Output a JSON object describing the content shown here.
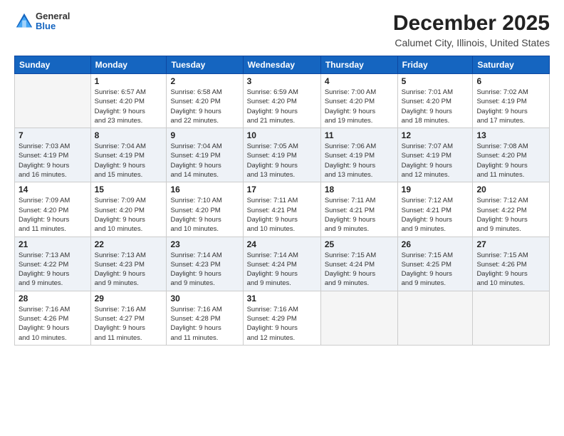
{
  "header": {
    "logo": {
      "general": "General",
      "blue": "Blue"
    },
    "title": "December 2025",
    "subtitle": "Calumet City, Illinois, United States"
  },
  "calendar": {
    "days_of_week": [
      "Sunday",
      "Monday",
      "Tuesday",
      "Wednesday",
      "Thursday",
      "Friday",
      "Saturday"
    ],
    "weeks": [
      [
        {
          "num": "",
          "info": ""
        },
        {
          "num": "1",
          "info": "Sunrise: 6:57 AM\nSunset: 4:20 PM\nDaylight: 9 hours\nand 23 minutes."
        },
        {
          "num": "2",
          "info": "Sunrise: 6:58 AM\nSunset: 4:20 PM\nDaylight: 9 hours\nand 22 minutes."
        },
        {
          "num": "3",
          "info": "Sunrise: 6:59 AM\nSunset: 4:20 PM\nDaylight: 9 hours\nand 21 minutes."
        },
        {
          "num": "4",
          "info": "Sunrise: 7:00 AM\nSunset: 4:20 PM\nDaylight: 9 hours\nand 19 minutes."
        },
        {
          "num": "5",
          "info": "Sunrise: 7:01 AM\nSunset: 4:20 PM\nDaylight: 9 hours\nand 18 minutes."
        },
        {
          "num": "6",
          "info": "Sunrise: 7:02 AM\nSunset: 4:19 PM\nDaylight: 9 hours\nand 17 minutes."
        }
      ],
      [
        {
          "num": "7",
          "info": "Sunrise: 7:03 AM\nSunset: 4:19 PM\nDaylight: 9 hours\nand 16 minutes."
        },
        {
          "num": "8",
          "info": "Sunrise: 7:04 AM\nSunset: 4:19 PM\nDaylight: 9 hours\nand 15 minutes."
        },
        {
          "num": "9",
          "info": "Sunrise: 7:04 AM\nSunset: 4:19 PM\nDaylight: 9 hours\nand 14 minutes."
        },
        {
          "num": "10",
          "info": "Sunrise: 7:05 AM\nSunset: 4:19 PM\nDaylight: 9 hours\nand 13 minutes."
        },
        {
          "num": "11",
          "info": "Sunrise: 7:06 AM\nSunset: 4:19 PM\nDaylight: 9 hours\nand 13 minutes."
        },
        {
          "num": "12",
          "info": "Sunrise: 7:07 AM\nSunset: 4:19 PM\nDaylight: 9 hours\nand 12 minutes."
        },
        {
          "num": "13",
          "info": "Sunrise: 7:08 AM\nSunset: 4:20 PM\nDaylight: 9 hours\nand 11 minutes."
        }
      ],
      [
        {
          "num": "14",
          "info": "Sunrise: 7:09 AM\nSunset: 4:20 PM\nDaylight: 9 hours\nand 11 minutes."
        },
        {
          "num": "15",
          "info": "Sunrise: 7:09 AM\nSunset: 4:20 PM\nDaylight: 9 hours\nand 10 minutes."
        },
        {
          "num": "16",
          "info": "Sunrise: 7:10 AM\nSunset: 4:20 PM\nDaylight: 9 hours\nand 10 minutes."
        },
        {
          "num": "17",
          "info": "Sunrise: 7:11 AM\nSunset: 4:21 PM\nDaylight: 9 hours\nand 10 minutes."
        },
        {
          "num": "18",
          "info": "Sunrise: 7:11 AM\nSunset: 4:21 PM\nDaylight: 9 hours\nand 9 minutes."
        },
        {
          "num": "19",
          "info": "Sunrise: 7:12 AM\nSunset: 4:21 PM\nDaylight: 9 hours\nand 9 minutes."
        },
        {
          "num": "20",
          "info": "Sunrise: 7:12 AM\nSunset: 4:22 PM\nDaylight: 9 hours\nand 9 minutes."
        }
      ],
      [
        {
          "num": "21",
          "info": "Sunrise: 7:13 AM\nSunset: 4:22 PM\nDaylight: 9 hours\nand 9 minutes."
        },
        {
          "num": "22",
          "info": "Sunrise: 7:13 AM\nSunset: 4:23 PM\nDaylight: 9 hours\nand 9 minutes."
        },
        {
          "num": "23",
          "info": "Sunrise: 7:14 AM\nSunset: 4:23 PM\nDaylight: 9 hours\nand 9 minutes."
        },
        {
          "num": "24",
          "info": "Sunrise: 7:14 AM\nSunset: 4:24 PM\nDaylight: 9 hours\nand 9 minutes."
        },
        {
          "num": "25",
          "info": "Sunrise: 7:15 AM\nSunset: 4:24 PM\nDaylight: 9 hours\nand 9 minutes."
        },
        {
          "num": "26",
          "info": "Sunrise: 7:15 AM\nSunset: 4:25 PM\nDaylight: 9 hours\nand 9 minutes."
        },
        {
          "num": "27",
          "info": "Sunrise: 7:15 AM\nSunset: 4:26 PM\nDaylight: 9 hours\nand 10 minutes."
        }
      ],
      [
        {
          "num": "28",
          "info": "Sunrise: 7:16 AM\nSunset: 4:26 PM\nDaylight: 9 hours\nand 10 minutes."
        },
        {
          "num": "29",
          "info": "Sunrise: 7:16 AM\nSunset: 4:27 PM\nDaylight: 9 hours\nand 11 minutes."
        },
        {
          "num": "30",
          "info": "Sunrise: 7:16 AM\nSunset: 4:28 PM\nDaylight: 9 hours\nand 11 minutes."
        },
        {
          "num": "31",
          "info": "Sunrise: 7:16 AM\nSunset: 4:29 PM\nDaylight: 9 hours\nand 12 minutes."
        },
        {
          "num": "",
          "info": ""
        },
        {
          "num": "",
          "info": ""
        },
        {
          "num": "",
          "info": ""
        }
      ]
    ]
  }
}
